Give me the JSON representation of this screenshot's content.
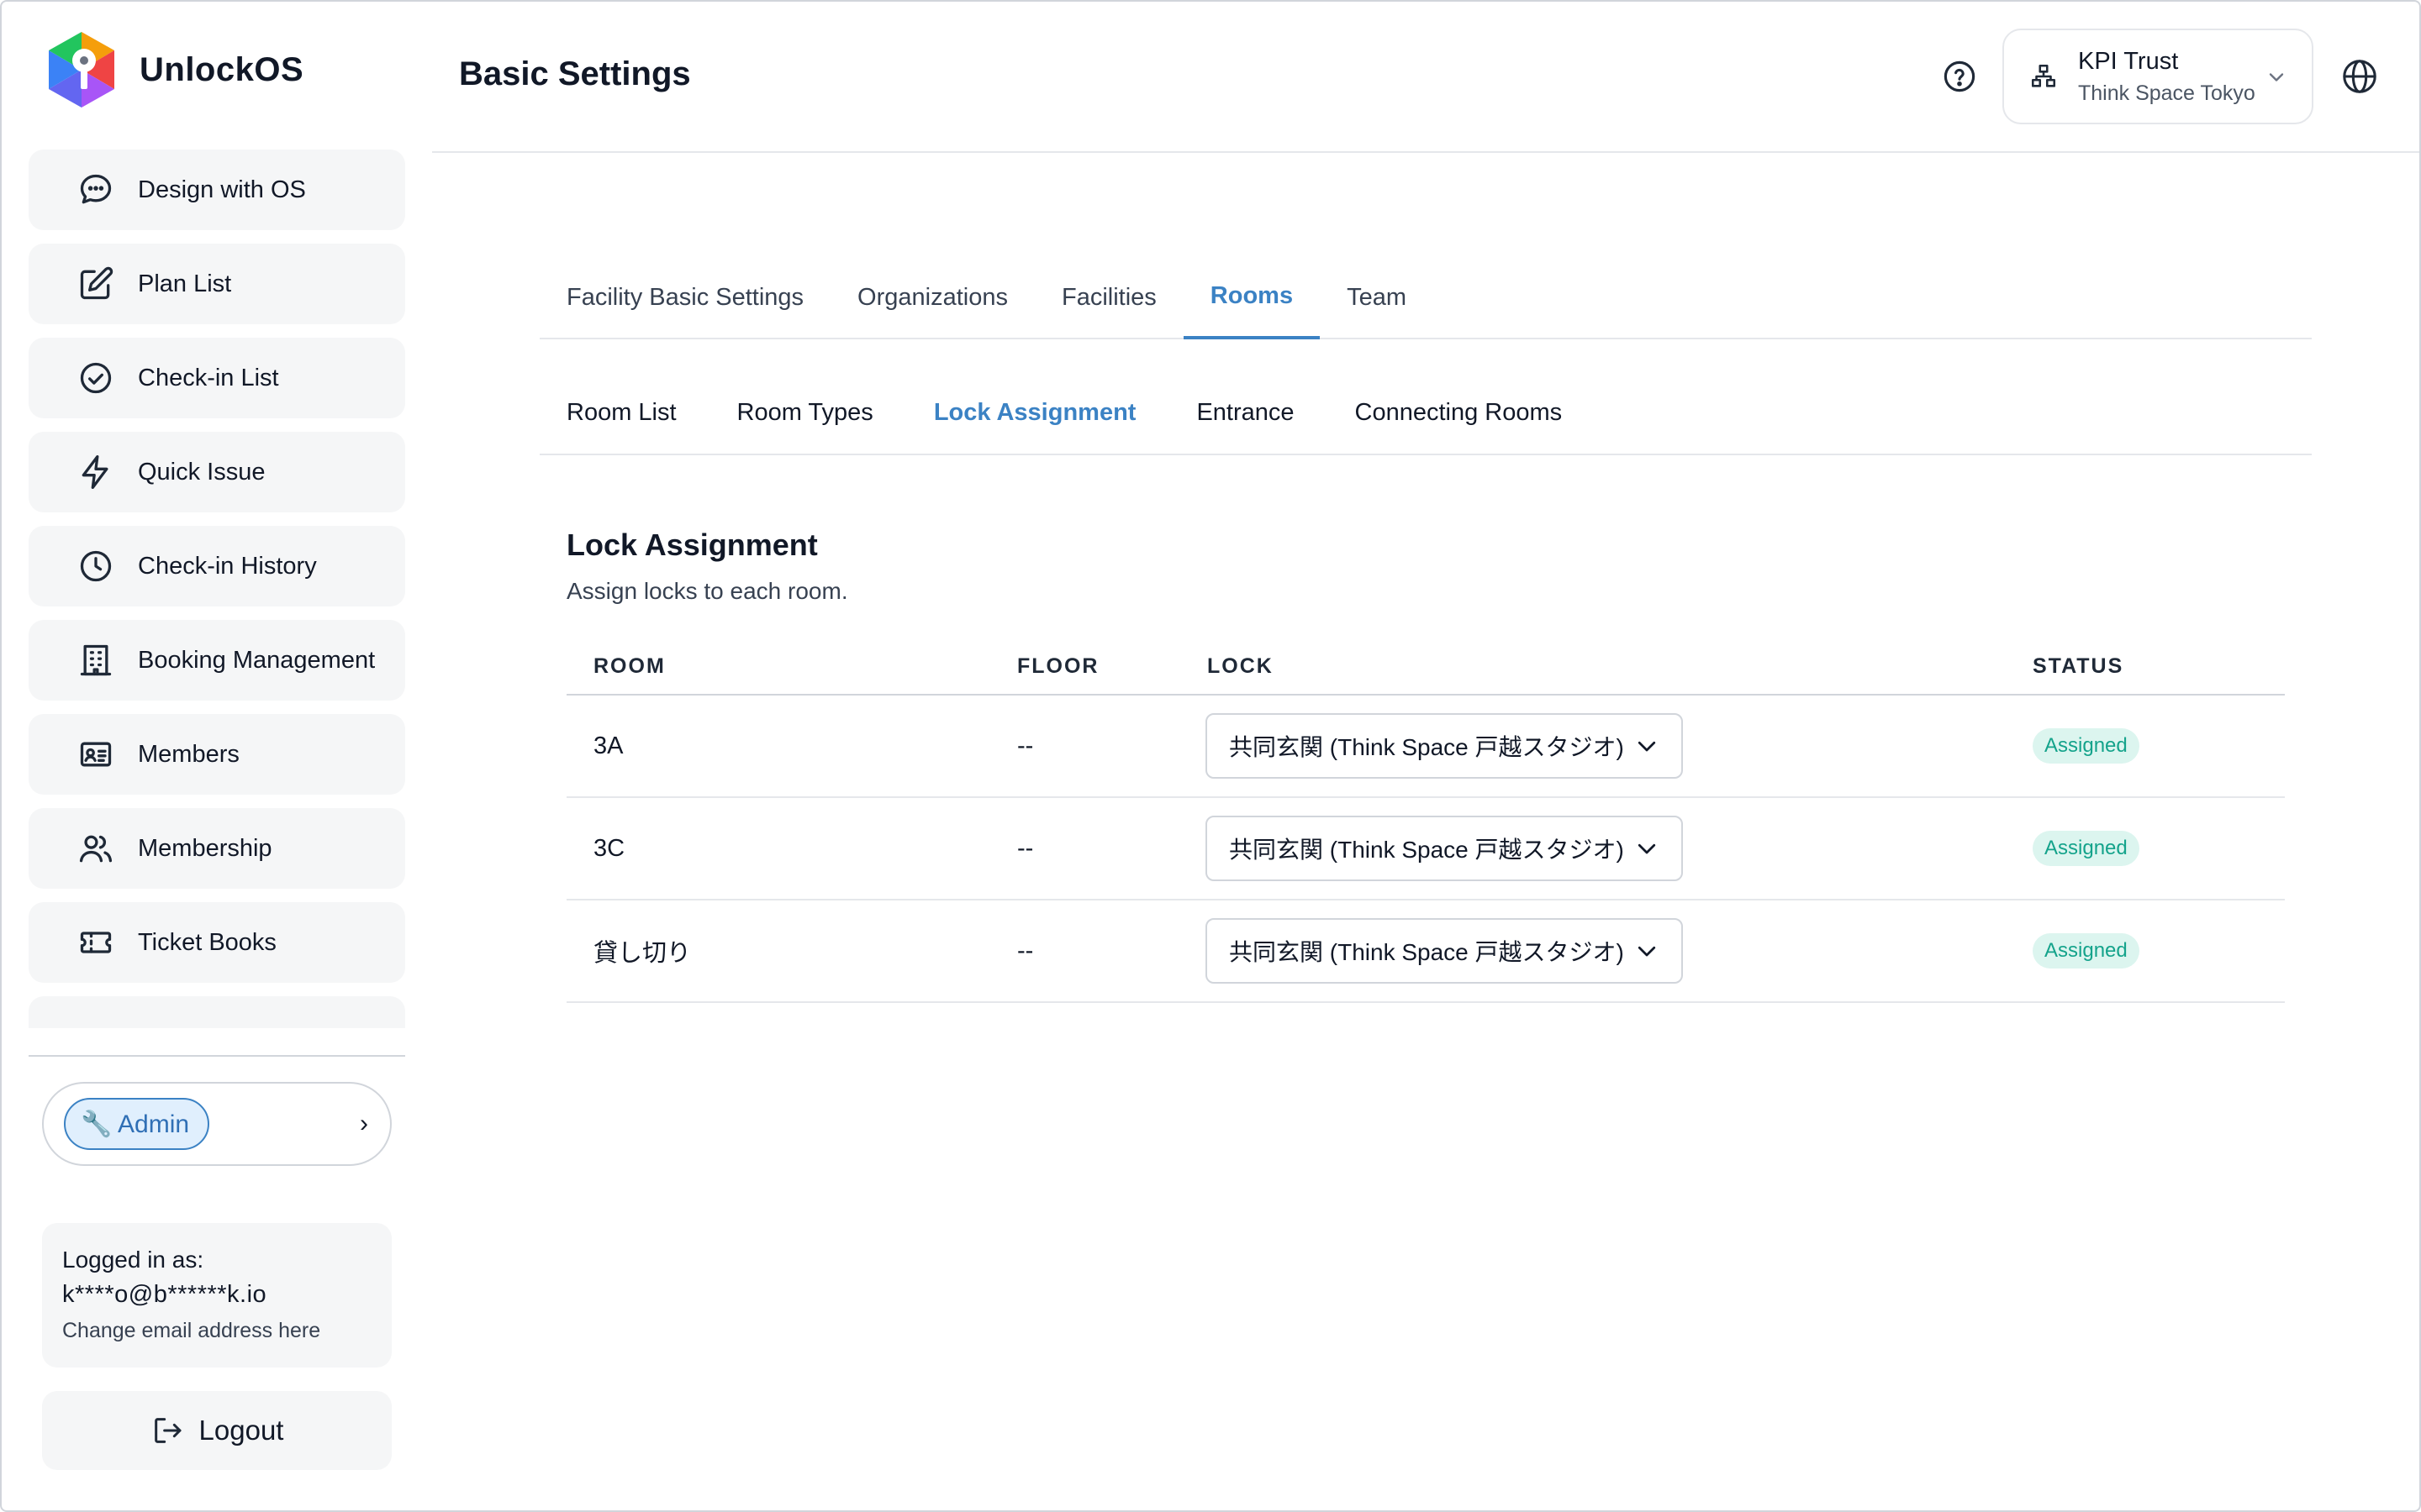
{
  "app": {
    "name": "UnlockOS"
  },
  "sidebar": {
    "items": [
      {
        "label": "Design with OS",
        "icon": "chat-bubble-icon"
      },
      {
        "label": "Plan List",
        "icon": "edit-icon"
      },
      {
        "label": "Check-in List",
        "icon": "check-circle-icon"
      },
      {
        "label": "Quick Issue",
        "icon": "lightning-icon"
      },
      {
        "label": "Check-in History",
        "icon": "clock-icon"
      },
      {
        "label": "Booking Management",
        "icon": "building-icon"
      },
      {
        "label": "Members",
        "icon": "id-card-icon"
      },
      {
        "label": "Membership",
        "icon": "users-icon"
      },
      {
        "label": "Ticket Books",
        "icon": "ticket-icon"
      }
    ],
    "role": {
      "label": "🔧 Admin"
    },
    "login": {
      "label": "Logged in as:",
      "email": "k****o@b******k.io",
      "change": "Change email address here"
    },
    "logout": "Logout"
  },
  "header": {
    "title": "Basic Settings",
    "org": {
      "name": "KPI Trust",
      "sub": "Think Space Tokyo"
    }
  },
  "tabs": [
    "Facility Basic Settings",
    "Organizations",
    "Facilities",
    "Rooms",
    "Team"
  ],
  "active_tab": "Rooms",
  "subtabs": [
    "Room List",
    "Room Types",
    "Lock Assignment",
    "Entrance",
    "Connecting Rooms"
  ],
  "active_subtab": "Lock Assignment",
  "section": {
    "title": "Lock Assignment",
    "description": "Assign locks to each room."
  },
  "table": {
    "columns": [
      "ROOM",
      "FLOOR",
      "LOCK",
      "STATUS"
    ],
    "rows": [
      {
        "room": "3A",
        "floor": "--",
        "lock": "共同玄関 (Think Space 戸越スタジオ)",
        "status": "Assigned"
      },
      {
        "room": "3C",
        "floor": "--",
        "lock": "共同玄関 (Think Space 戸越スタジオ)",
        "status": "Assigned"
      },
      {
        "room": "貸し切り",
        "floor": "--",
        "lock": "共同玄関 (Think Space 戸越スタジオ)",
        "status": "Assigned"
      }
    ]
  },
  "colors": {
    "accent": "#3b82c4",
    "status_assigned": "#14a38b"
  }
}
